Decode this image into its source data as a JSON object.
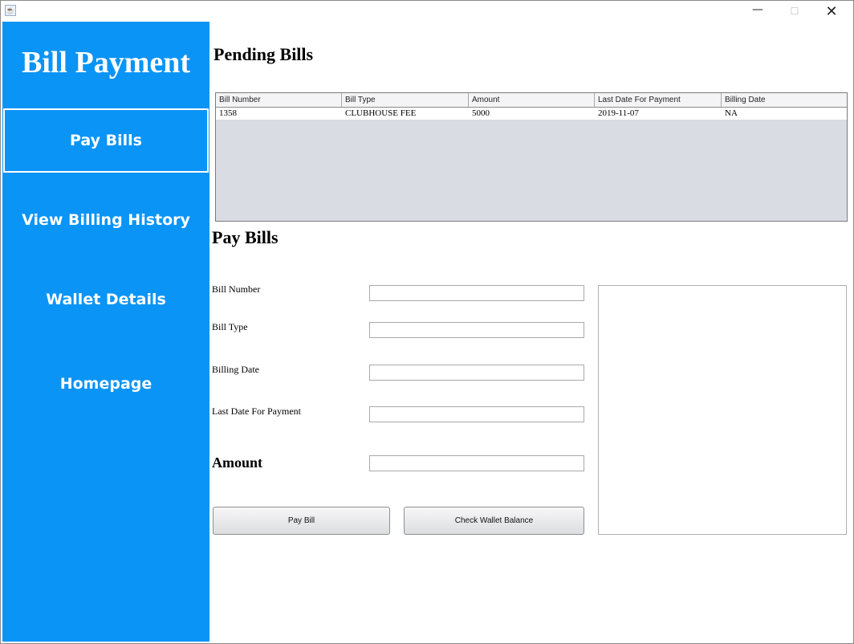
{
  "window": {
    "minimize_glyph": "—",
    "maximize_glyph": "☐",
    "close_glyph": "✕",
    "app_icon": "java-icon"
  },
  "sidebar": {
    "brand": "Bill Payment",
    "items": [
      {
        "label": "Pay Bills",
        "active": true
      },
      {
        "label": "View Billing History",
        "active": false
      },
      {
        "label": "Wallet Details",
        "active": false
      },
      {
        "label": "Homepage",
        "active": false
      }
    ]
  },
  "pending": {
    "title": "Pending Bills",
    "columns": [
      "Bill Number",
      "Bill Type",
      "Amount",
      "Last Date For Payment",
      "Billing Date"
    ],
    "rows": [
      [
        "1358",
        "CLUBHOUSE FEE",
        "5000",
        "2019-11-07",
        "NA"
      ]
    ]
  },
  "form": {
    "title": "Pay Bills",
    "bill_number_label": "Bill Number",
    "bill_type_label": "Bill Type",
    "billing_date_label": "Billing Date",
    "last_date_label": "Last Date For Payment",
    "amount_label": "Amount",
    "bill_number_value": "",
    "bill_type_value": "",
    "billing_date_value": "",
    "last_date_value": "",
    "amount_value": "",
    "pay_button": "Pay Bill",
    "wallet_button": "Check Wallet Balance",
    "output_text": ""
  },
  "colors": {
    "sidebar": "#0a94f6",
    "table_bg": "#d9dce3"
  }
}
